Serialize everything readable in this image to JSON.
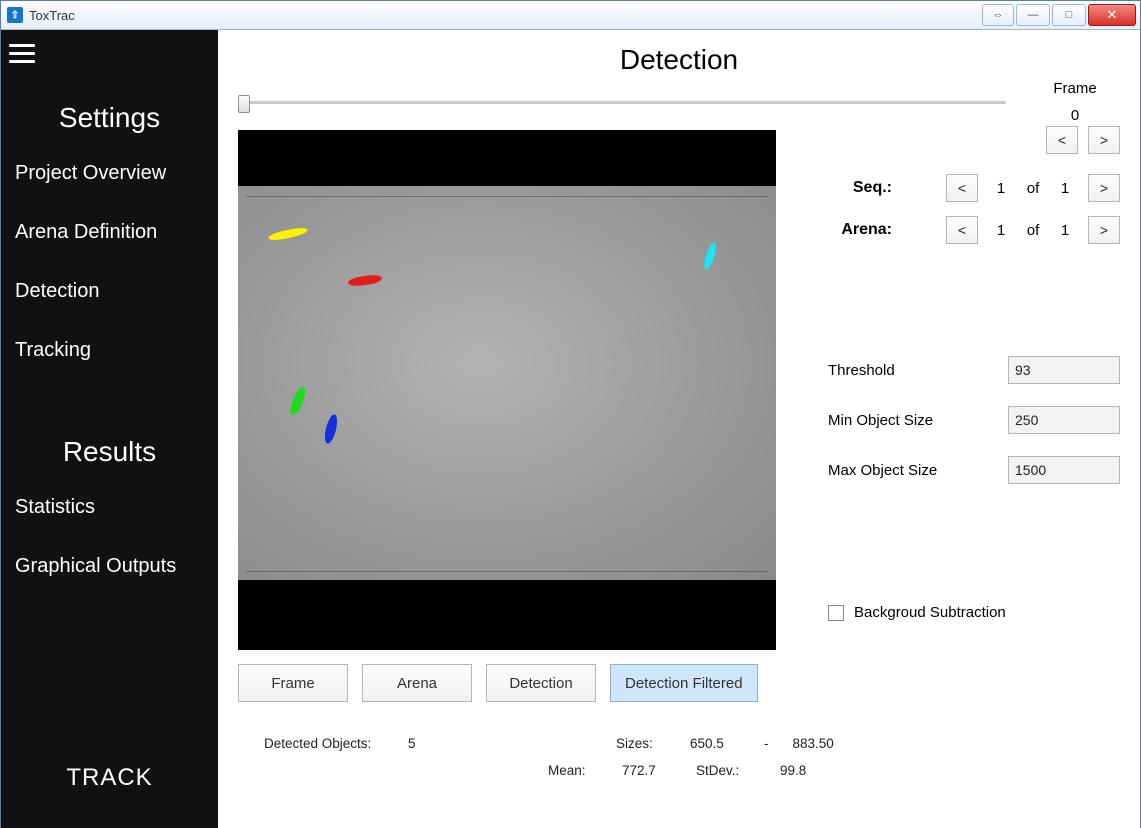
{
  "app": {
    "title": "ToxTrac"
  },
  "sidebar": {
    "heading_settings": "Settings",
    "heading_results": "Results",
    "items": {
      "project_overview": "Project Overview",
      "arena_definition": "Arena Definition",
      "detection": "Detection",
      "tracking": "Tracking",
      "statistics": "Statistics",
      "graphical_outputs": "Graphical Outputs"
    },
    "track_button": "TRACK"
  },
  "main": {
    "title": "Detection",
    "frame": {
      "label": "Frame",
      "value": "0",
      "prev": "<",
      "next": ">"
    },
    "seq": {
      "label": "Seq.:",
      "prev": "<",
      "index": "1",
      "of": "of",
      "total": "1",
      "next": ">"
    },
    "arena": {
      "label": "Arena:",
      "prev": "<",
      "index": "1",
      "of": "of",
      "total": "1",
      "next": ">"
    },
    "params": {
      "threshold": {
        "label": "Threshold",
        "value": "93"
      },
      "min_size": {
        "label": "Min Object Size",
        "value": "250"
      },
      "max_size": {
        "label": "Max Object Size",
        "value": "1500"
      }
    },
    "bg_sub": {
      "label": "Backgroud Subtraction"
    },
    "tabs": {
      "frame": "Frame",
      "arena": "Arena",
      "detection": "Detection",
      "detection_filtered": "Detection Filtered"
    },
    "stats": {
      "detected_label": "Detected Objects:",
      "detected_count": "5",
      "sizes_label": "Sizes:",
      "sizes_min": "650.5",
      "sizes_dash": "-",
      "sizes_max": "883.50",
      "mean_label": "Mean:",
      "mean_val": "772.7",
      "stdev_label": "StDev.:",
      "stdev_val": "99.8"
    }
  }
}
